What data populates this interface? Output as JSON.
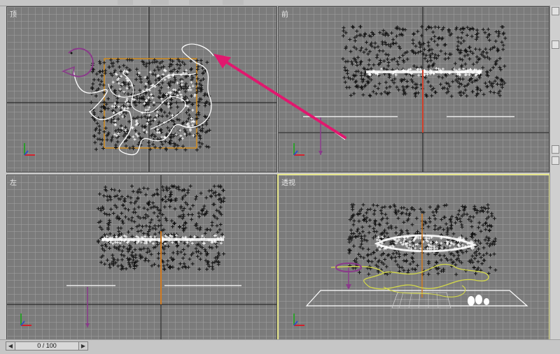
{
  "viewports": {
    "top": {
      "label": "顶"
    },
    "front": {
      "label": "前"
    },
    "left": {
      "label": "左"
    },
    "perspective": {
      "label": "透视"
    }
  },
  "timeline": {
    "frame": "0 / 100",
    "prev_icon": "arrow-left-icon",
    "next_icon": "arrow-right-icon"
  },
  "colors": {
    "viewport_bg": "#7b7b7b",
    "active_border": "#e6e68c",
    "annotation_arrow": "#e0186e",
    "axis_x": "#d0202a",
    "axis_y": "#2a9d2a",
    "axis_z": "#3050c0",
    "gizmo": "#8a3a8a",
    "bounding_box": "#d08a1a"
  }
}
